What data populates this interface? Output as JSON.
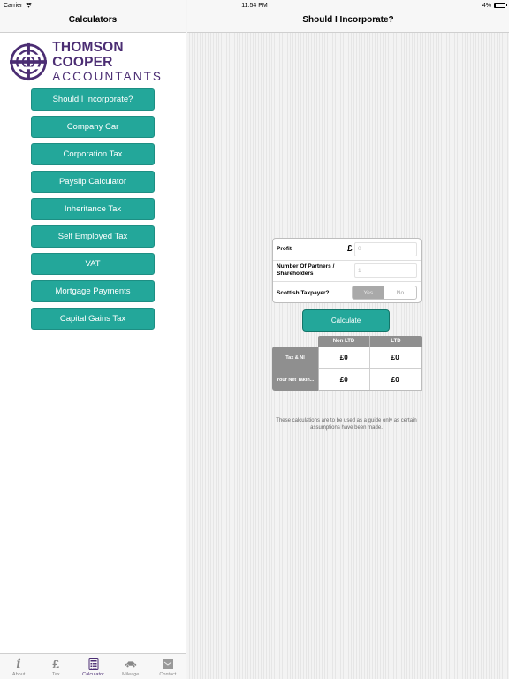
{
  "status": {
    "carrier": "Carrier",
    "time": "11:54 PM",
    "battery": "4%",
    "battery_level": 0.04
  },
  "sidebar": {
    "title": "Calculators",
    "logo": {
      "line1": "THOMSON COOPER",
      "line2": "ACCOUNTANTS"
    },
    "items": [
      {
        "label": "Should I Incorporate?"
      },
      {
        "label": "Company Car"
      },
      {
        "label": "Corporation Tax"
      },
      {
        "label": "Payslip Calculator"
      },
      {
        "label": "Inheritance Tax"
      },
      {
        "label": "Self Employed Tax"
      },
      {
        "label": "VAT"
      },
      {
        "label": "Mortgage Payments"
      },
      {
        "label": "Capital Gains Tax"
      }
    ]
  },
  "tabbar": {
    "tabs": [
      {
        "label": "About",
        "icon": "info-icon"
      },
      {
        "label": "Tax",
        "icon": "pound-icon"
      },
      {
        "label": "Calculator",
        "icon": "calculator-icon",
        "active": true
      },
      {
        "label": "Mileage",
        "icon": "car-icon"
      },
      {
        "label": "Contact",
        "icon": "mail-icon"
      }
    ]
  },
  "detail": {
    "title": "Should I Incorporate?",
    "form": {
      "profit_label": "Profit",
      "currency": "£",
      "profit_placeholder": "0",
      "partners_label": "Number Of Partners / Shareholders",
      "partners_placeholder": "1",
      "scottish_label": "Scottish Taxpayer?",
      "yes": "Yes",
      "no": "No",
      "selected": "Yes"
    },
    "calculate_label": "Calculate",
    "results": {
      "columns": [
        "Non LTD",
        "LTD"
      ],
      "rows": [
        {
          "label": "Tax & NI",
          "values": [
            "£0",
            "£0"
          ]
        },
        {
          "label": "Your Net Takin...",
          "values": [
            "£0",
            "£0"
          ]
        }
      ]
    },
    "disclaimer": "These calculations are to be used as a guide only as certain assumptions have been made."
  }
}
